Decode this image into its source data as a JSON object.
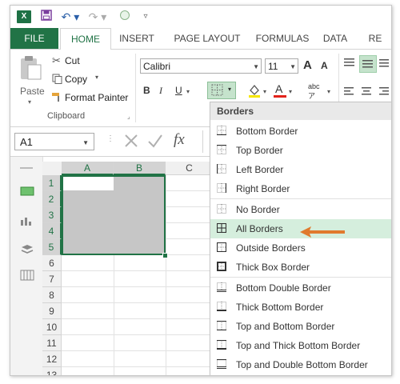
{
  "qat": {
    "logo": "X"
  },
  "tabs": [
    "FILE",
    "HOME",
    "INSERT",
    "PAGE LAYOUT",
    "FORMULAS",
    "DATA",
    "RE"
  ],
  "clipboard": {
    "paste": "Paste",
    "cut": "Cut",
    "copy": "Copy",
    "format_painter": "Format Painter",
    "group": "Clipboard"
  },
  "font": {
    "name": "Calibri",
    "size": "11",
    "bold": "B",
    "italic": "I",
    "underline": "U",
    "grow": "A",
    "shrink": "A"
  },
  "formula_bar": {
    "name_box": "A1",
    "fx": "fx"
  },
  "grid": {
    "columns": [
      "A",
      "B",
      "C"
    ],
    "rows": [
      "1",
      "2",
      "3",
      "4",
      "5",
      "6",
      "7",
      "8",
      "9",
      "10",
      "11",
      "12",
      "13"
    ]
  },
  "menu": {
    "title": "Borders",
    "items": [
      {
        "label": "Bottom Border",
        "icon": "border-bottom-icon"
      },
      {
        "label": "Top Border",
        "icon": "border-top-icon"
      },
      {
        "label": "Left Border",
        "icon": "border-left-icon"
      },
      {
        "label": "Right Border",
        "icon": "border-right-icon"
      },
      {
        "label": "No Border",
        "icon": "border-none-icon"
      },
      {
        "label": "All Borders",
        "icon": "border-all-icon"
      },
      {
        "label": "Outside Borders",
        "icon": "border-outside-icon"
      },
      {
        "label": "Thick Box Border",
        "icon": "border-thick-box-icon"
      },
      {
        "label": "Bottom Double Border",
        "icon": "border-bottom-double-icon"
      },
      {
        "label": "Thick Bottom Border",
        "icon": "border-thick-bottom-icon"
      },
      {
        "label": "Top and Bottom Border",
        "icon": "border-top-bottom-icon"
      },
      {
        "label": "Top and Thick Bottom Border",
        "icon": "border-top-thick-bottom-icon"
      },
      {
        "label": "Top and Double Bottom Border",
        "icon": "border-top-double-bottom-icon"
      }
    ],
    "highlighted": "All Borders"
  },
  "colors": {
    "excel_green": "#217346",
    "highlight": "#d5eedd",
    "arrow": "#e07a2e",
    "selection": "#c6c6c6"
  }
}
